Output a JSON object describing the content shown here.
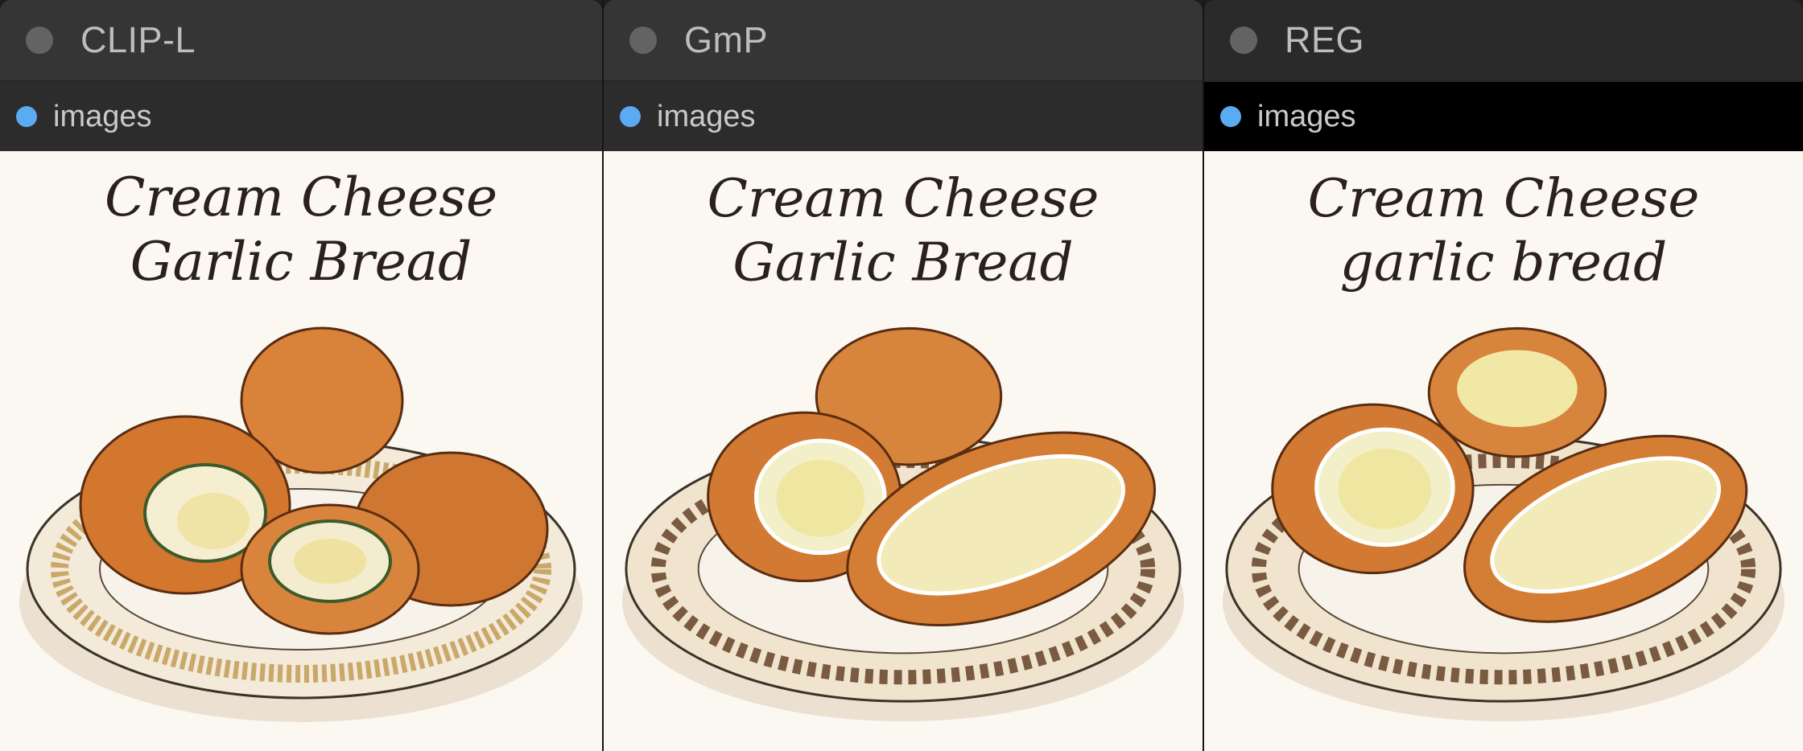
{
  "panels": [
    {
      "title": "CLIP-L",
      "node_label": "images",
      "image_caption_line1": "Cream Cheese",
      "image_caption_line2": "Garlic Bread"
    },
    {
      "title": "GmP",
      "node_label": "images",
      "image_caption_line1": "Cream Cheese",
      "image_caption_line2": "Garlic Bread"
    },
    {
      "title": "REG",
      "node_label": "images",
      "image_caption_line1": "Cream Cheese",
      "image_caption_line2": "garlic bread"
    }
  ],
  "colors": {
    "accent_dot": "#5aabf2",
    "status_dot": "#636363"
  },
  "icons": [
    "status-dot-icon",
    "node-dot-icon"
  ]
}
